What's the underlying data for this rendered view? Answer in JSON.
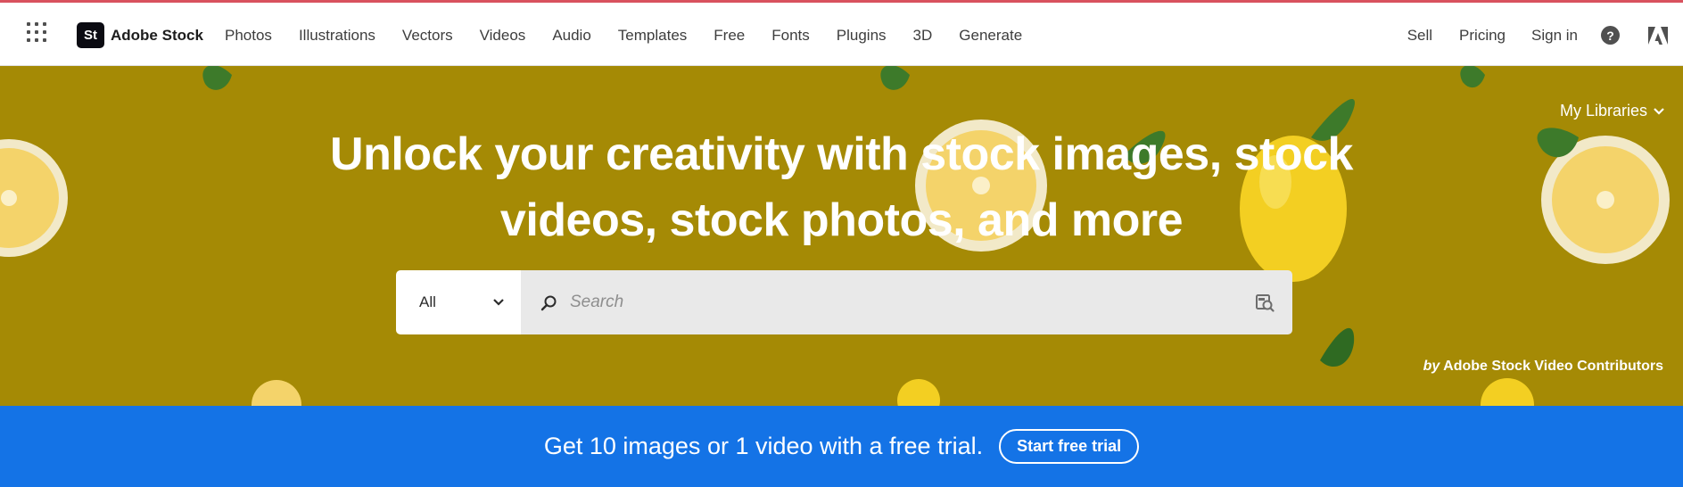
{
  "header": {
    "brand_initials": "St",
    "brand_name": "Adobe Stock",
    "nav": [
      "Photos",
      "Illustrations",
      "Vectors",
      "Videos",
      "Audio",
      "Templates",
      "Free",
      "Fonts",
      "Plugins",
      "3D",
      "Generate"
    ],
    "right": {
      "sell": "Sell",
      "pricing": "Pricing",
      "sign_in": "Sign in",
      "help_glyph": "?"
    }
  },
  "hero": {
    "my_libraries": "My Libraries",
    "headline_line1": "Unlock your creativity with stock images, stock",
    "headline_line2": "videos, stock photos, and more",
    "search": {
      "scope": "All",
      "placeholder": "Search"
    },
    "credit_by": "by",
    "credit_name": "Adobe Stock Video Contributors"
  },
  "promo": {
    "text": "Get 10 images or 1 video with a free trial.",
    "button": "Start free trial"
  },
  "colors": {
    "accent_top_line": "#d9525e",
    "hero_background": "#a58a05",
    "promo_background": "#1473e6"
  },
  "icons": [
    "app-switcher-icon",
    "search-icon",
    "visual-search-icon",
    "chevron-down-icon",
    "help-icon",
    "adobe-logo-icon"
  ]
}
